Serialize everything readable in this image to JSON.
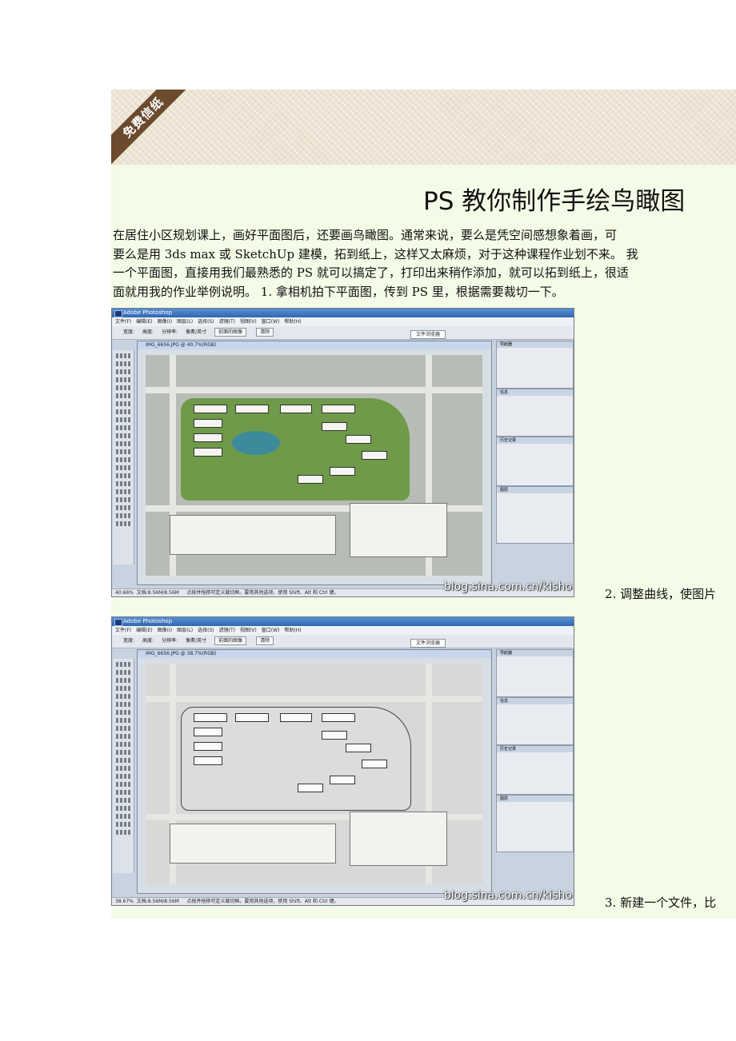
{
  "banner": {
    "ribbon_text": "免费信纸"
  },
  "title": "PS 教你制作手绘鸟瞰图",
  "paragraph_lines": [
    "在居住小区规划课上，画好平面图后，还要画鸟瞰图。通常来说，要么是凭空间感想象着画，可",
    "要么是用 3ds max 或 SketchUp 建模，拓到纸上，这样又太麻烦，对于这种课程作业划不来。   我",
    "一个平面图，直接用我们最熟悉的 PS 就可以搞定了，打印出来稍作添加，就可以拓到纸上，很适",
    "面就用我的作业举例说明。  1. 拿相机拍下平面图，传到 PS 里，根据需要裁切一下。"
  ],
  "screenshots": [
    {
      "app_title": "Adobe Photoshop",
      "menu": [
        "文件(F)",
        "编辑(E)",
        "图像(I)",
        "图层(L)",
        "选择(S)",
        "滤镜(T)",
        "视图(V)",
        "窗口(W)",
        "帮助(H)"
      ],
      "options": [
        "宽度:",
        "高度:",
        "分辨率:",
        "像素/英寸"
      ],
      "option_buttons": [
        "前面的图像",
        "清除"
      ],
      "tab": "文件浏览器",
      "doc_title": "IMG_6656.JPG @ 40.7%(RGB)",
      "status_zoom": "40.66%",
      "status_doc": "文档:8.56M/8.56M",
      "status_hint": "点按并拖移可定义裁切框。要用其他选项，使用 Shift、Alt 和 Ctrl 键。",
      "panels": [
        "导航器",
        "信息",
        "历史记录",
        "图层"
      ],
      "watermark": "blog.sina.com.cn/kisho",
      "color_mode": "color"
    },
    {
      "app_title": "Adobe Photoshop",
      "menu": [
        "文件(F)",
        "编辑(E)",
        "图像(I)",
        "图层(L)",
        "选择(S)",
        "滤镜(T)",
        "视图(V)",
        "窗口(W)",
        "帮助(H)"
      ],
      "options": [
        "宽度:",
        "高度:",
        "分辨率:",
        "像素/英寸"
      ],
      "option_buttons": [
        "前面的图像",
        "清除"
      ],
      "tab": "文件浏览器",
      "doc_title": "IMG_6656.JPG @ 38.7%(RGB)",
      "status_zoom": "38.67%",
      "status_doc": "文档:8.56M/8.56M",
      "status_hint": "点按并拖移可定义裁切框。要用其他选项，使用 Shift、Alt 和 Ctrl 键。",
      "panels": [
        "导航器",
        "信息",
        "历史记录",
        "图层"
      ],
      "watermark": "blog.sina.com.cn/kisho",
      "color_mode": "bw"
    }
  ],
  "captions": [
    "2. 调整曲线，使图片",
    "3. 新建一个文件，比"
  ]
}
